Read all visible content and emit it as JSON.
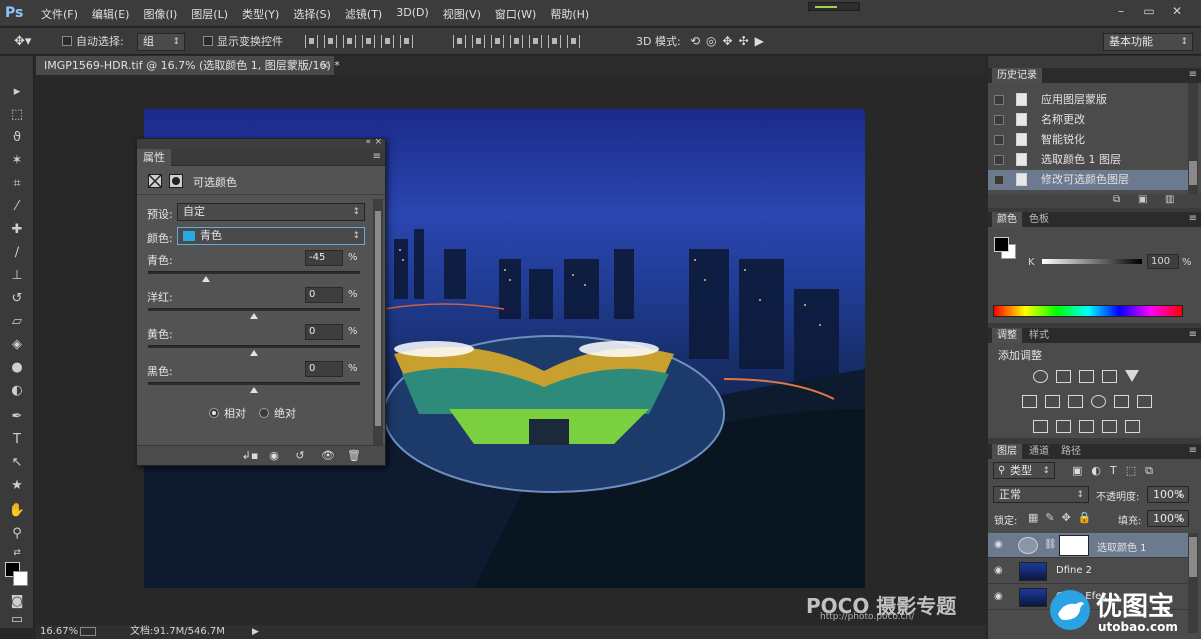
{
  "app": {
    "logo": "Ps"
  },
  "menu": [
    "文件(F)",
    "编辑(E)",
    "图像(I)",
    "图层(L)",
    "类型(Y)",
    "选择(S)",
    "滤镜(T)",
    "3D(D)",
    "视图(V)",
    "窗口(W)",
    "帮助(H)"
  ],
  "window_controls": {
    "minimize": "–",
    "restore": "▭",
    "close": "✕"
  },
  "options": {
    "auto_select_label": "自动选择:",
    "auto_select_value": "组",
    "show_transform_label": "显示变换控件",
    "mode_3d_label": "3D 模式:",
    "workspace": "基本功能"
  },
  "document": {
    "tab_title": "IMGP1569-HDR.tif @ 16.7% (选取颜色 1, 图层蒙版/16) *",
    "close": "×"
  },
  "status": {
    "zoom": "16.67%",
    "doc_size": "文档:91.7M/546.7M"
  },
  "watermark": {
    "text": "POCO 摄影专题",
    "url": "http://photo.poco.cn/"
  },
  "properties": {
    "tab": "属性",
    "title": "可选颜色",
    "preset_label": "预设:",
    "preset_value": "自定",
    "color_label": "颜色:",
    "color_value": "青色",
    "color_swatch": "#29a8e8",
    "sliders": [
      {
        "label": "青色:",
        "value": "-45",
        "unit": "%",
        "level": -45
      },
      {
        "label": "洋红:",
        "value": "0",
        "unit": "%",
        "level": 0
      },
      {
        "label": "黄色:",
        "value": "0",
        "unit": "%",
        "level": 0
      },
      {
        "label": "黑色:",
        "value": "0",
        "unit": "%",
        "level": 0
      }
    ],
    "method_relative": "相对",
    "method_absolute": "绝对"
  },
  "history": {
    "tab": "历史记录",
    "items": [
      "应用图层蒙版",
      "名称更改",
      "智能锐化",
      "选取颜色 1 图层",
      "修改可选颜色图层"
    ]
  },
  "color_panel": {
    "tabs": [
      "颜色",
      "色板"
    ],
    "channel_label": "K",
    "value": "100",
    "unit": "%"
  },
  "adjustments": {
    "tabs": [
      "调整",
      "样式"
    ],
    "title": "添加调整"
  },
  "layers": {
    "tabs": [
      "图层",
      "通道",
      "路径"
    ],
    "filter_kind": "类型",
    "blend_mode": "正常",
    "opacity_label": "不透明度:",
    "opacity_value": "100%",
    "lock_label": "锁定:",
    "fill_label": "填充:",
    "fill_value": "100%",
    "items": [
      "选取颜色 1",
      "Dfine 2",
      "Color Efex"
    ]
  },
  "brand": {
    "name": "优图宝",
    "url": "utobao.com"
  }
}
